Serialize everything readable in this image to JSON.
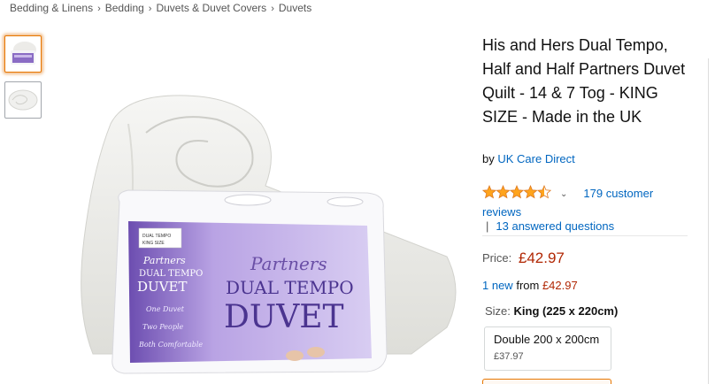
{
  "breadcrumb": {
    "items": [
      "Bedding & Linens",
      "Bedding",
      "Duvets & Duvet Covers",
      "Duvets"
    ],
    "separator": "›"
  },
  "gallery": {
    "thumbnails": [
      "duvet-package-thumbnail",
      "rolled-duvet-thumbnail"
    ],
    "selected_index": 0
  },
  "product_image": {
    "package_lines": [
      "Partners",
      "DUAL TEMPO",
      "DUVET"
    ],
    "package_script": [
      "One Duvet",
      "Two People",
      "Both Comfortable"
    ],
    "label_text": [
      "DUAL TEMPO",
      "KING SIZE"
    ]
  },
  "product": {
    "title": "His and Hers Dual Tempo, Half and Half Partners Duvet Quilt - 14 & 7 Tog - KING SIZE - Made in the UK",
    "by_label": "by",
    "brand": "UK Care Direct",
    "rating": 4.5,
    "rating_icon": "chevron-down-icon",
    "reviews_text": "179 customer reviews",
    "reviews_count": "179",
    "pipe": "|",
    "answered_questions": "13 answered questions",
    "price_label": "Price:",
    "price": "£42.97",
    "new_link": "1 new",
    "new_from_label": "from",
    "new_from_price": "£42.97",
    "size_label": "Size:",
    "size_selected": "King (225 x 220cm)",
    "size_options": [
      {
        "label": "Double 200 x 200cm",
        "price": "£37.97"
      }
    ]
  },
  "colors": {
    "link": "#0066c0",
    "price": "#b12704",
    "star": "#ffa41c",
    "selected_border": "#e77600",
    "package_purple": "#7b5ab7"
  }
}
